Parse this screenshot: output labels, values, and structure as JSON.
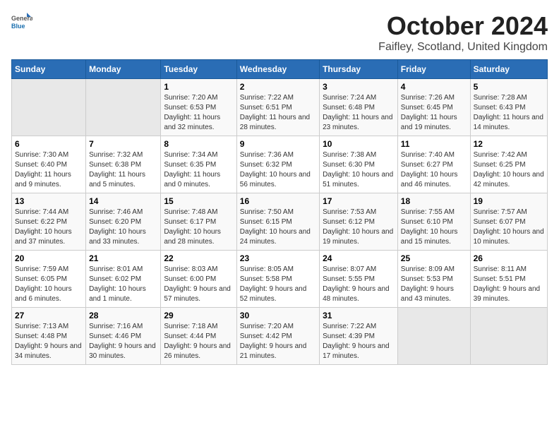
{
  "header": {
    "logo_general": "General",
    "logo_blue": "Blue",
    "title": "October 2024",
    "subtitle": "Faifley, Scotland, United Kingdom"
  },
  "days_of_week": [
    "Sunday",
    "Monday",
    "Tuesday",
    "Wednesday",
    "Thursday",
    "Friday",
    "Saturday"
  ],
  "weeks": [
    [
      {
        "day": "",
        "sunrise": "",
        "sunset": "",
        "daylight": "",
        "empty": true
      },
      {
        "day": "",
        "sunrise": "",
        "sunset": "",
        "daylight": "",
        "empty": true
      },
      {
        "day": "1",
        "sunrise": "Sunrise: 7:20 AM",
        "sunset": "Sunset: 6:53 PM",
        "daylight": "Daylight: 11 hours and 32 minutes."
      },
      {
        "day": "2",
        "sunrise": "Sunrise: 7:22 AM",
        "sunset": "Sunset: 6:51 PM",
        "daylight": "Daylight: 11 hours and 28 minutes."
      },
      {
        "day": "3",
        "sunrise": "Sunrise: 7:24 AM",
        "sunset": "Sunset: 6:48 PM",
        "daylight": "Daylight: 11 hours and 23 minutes."
      },
      {
        "day": "4",
        "sunrise": "Sunrise: 7:26 AM",
        "sunset": "Sunset: 6:45 PM",
        "daylight": "Daylight: 11 hours and 19 minutes."
      },
      {
        "day": "5",
        "sunrise": "Sunrise: 7:28 AM",
        "sunset": "Sunset: 6:43 PM",
        "daylight": "Daylight: 11 hours and 14 minutes."
      }
    ],
    [
      {
        "day": "6",
        "sunrise": "Sunrise: 7:30 AM",
        "sunset": "Sunset: 6:40 PM",
        "daylight": "Daylight: 11 hours and 9 minutes."
      },
      {
        "day": "7",
        "sunrise": "Sunrise: 7:32 AM",
        "sunset": "Sunset: 6:38 PM",
        "daylight": "Daylight: 11 hours and 5 minutes."
      },
      {
        "day": "8",
        "sunrise": "Sunrise: 7:34 AM",
        "sunset": "Sunset: 6:35 PM",
        "daylight": "Daylight: 11 hours and 0 minutes."
      },
      {
        "day": "9",
        "sunrise": "Sunrise: 7:36 AM",
        "sunset": "Sunset: 6:32 PM",
        "daylight": "Daylight: 10 hours and 56 minutes."
      },
      {
        "day": "10",
        "sunrise": "Sunrise: 7:38 AM",
        "sunset": "Sunset: 6:30 PM",
        "daylight": "Daylight: 10 hours and 51 minutes."
      },
      {
        "day": "11",
        "sunrise": "Sunrise: 7:40 AM",
        "sunset": "Sunset: 6:27 PM",
        "daylight": "Daylight: 10 hours and 46 minutes."
      },
      {
        "day": "12",
        "sunrise": "Sunrise: 7:42 AM",
        "sunset": "Sunset: 6:25 PM",
        "daylight": "Daylight: 10 hours and 42 minutes."
      }
    ],
    [
      {
        "day": "13",
        "sunrise": "Sunrise: 7:44 AM",
        "sunset": "Sunset: 6:22 PM",
        "daylight": "Daylight: 10 hours and 37 minutes."
      },
      {
        "day": "14",
        "sunrise": "Sunrise: 7:46 AM",
        "sunset": "Sunset: 6:20 PM",
        "daylight": "Daylight: 10 hours and 33 minutes."
      },
      {
        "day": "15",
        "sunrise": "Sunrise: 7:48 AM",
        "sunset": "Sunset: 6:17 PM",
        "daylight": "Daylight: 10 hours and 28 minutes."
      },
      {
        "day": "16",
        "sunrise": "Sunrise: 7:50 AM",
        "sunset": "Sunset: 6:15 PM",
        "daylight": "Daylight: 10 hours and 24 minutes."
      },
      {
        "day": "17",
        "sunrise": "Sunrise: 7:53 AM",
        "sunset": "Sunset: 6:12 PM",
        "daylight": "Daylight: 10 hours and 19 minutes."
      },
      {
        "day": "18",
        "sunrise": "Sunrise: 7:55 AM",
        "sunset": "Sunset: 6:10 PM",
        "daylight": "Daylight: 10 hours and 15 minutes."
      },
      {
        "day": "19",
        "sunrise": "Sunrise: 7:57 AM",
        "sunset": "Sunset: 6:07 PM",
        "daylight": "Daylight: 10 hours and 10 minutes."
      }
    ],
    [
      {
        "day": "20",
        "sunrise": "Sunrise: 7:59 AM",
        "sunset": "Sunset: 6:05 PM",
        "daylight": "Daylight: 10 hours and 6 minutes."
      },
      {
        "day": "21",
        "sunrise": "Sunrise: 8:01 AM",
        "sunset": "Sunset: 6:02 PM",
        "daylight": "Daylight: 10 hours and 1 minute."
      },
      {
        "day": "22",
        "sunrise": "Sunrise: 8:03 AM",
        "sunset": "Sunset: 6:00 PM",
        "daylight": "Daylight: 9 hours and 57 minutes."
      },
      {
        "day": "23",
        "sunrise": "Sunrise: 8:05 AM",
        "sunset": "Sunset: 5:58 PM",
        "daylight": "Daylight: 9 hours and 52 minutes."
      },
      {
        "day": "24",
        "sunrise": "Sunrise: 8:07 AM",
        "sunset": "Sunset: 5:55 PM",
        "daylight": "Daylight: 9 hours and 48 minutes."
      },
      {
        "day": "25",
        "sunrise": "Sunrise: 8:09 AM",
        "sunset": "Sunset: 5:53 PM",
        "daylight": "Daylight: 9 hours and 43 minutes."
      },
      {
        "day": "26",
        "sunrise": "Sunrise: 8:11 AM",
        "sunset": "Sunset: 5:51 PM",
        "daylight": "Daylight: 9 hours and 39 minutes."
      }
    ],
    [
      {
        "day": "27",
        "sunrise": "Sunrise: 7:13 AM",
        "sunset": "Sunset: 4:48 PM",
        "daylight": "Daylight: 9 hours and 34 minutes."
      },
      {
        "day": "28",
        "sunrise": "Sunrise: 7:16 AM",
        "sunset": "Sunset: 4:46 PM",
        "daylight": "Daylight: 9 hours and 30 minutes."
      },
      {
        "day": "29",
        "sunrise": "Sunrise: 7:18 AM",
        "sunset": "Sunset: 4:44 PM",
        "daylight": "Daylight: 9 hours and 26 minutes."
      },
      {
        "day": "30",
        "sunrise": "Sunrise: 7:20 AM",
        "sunset": "Sunset: 4:42 PM",
        "daylight": "Daylight: 9 hours and 21 minutes."
      },
      {
        "day": "31",
        "sunrise": "Sunrise: 7:22 AM",
        "sunset": "Sunset: 4:39 PM",
        "daylight": "Daylight: 9 hours and 17 minutes."
      },
      {
        "day": "",
        "sunrise": "",
        "sunset": "",
        "daylight": "",
        "empty": true
      },
      {
        "day": "",
        "sunrise": "",
        "sunset": "",
        "daylight": "",
        "empty": true
      }
    ]
  ]
}
